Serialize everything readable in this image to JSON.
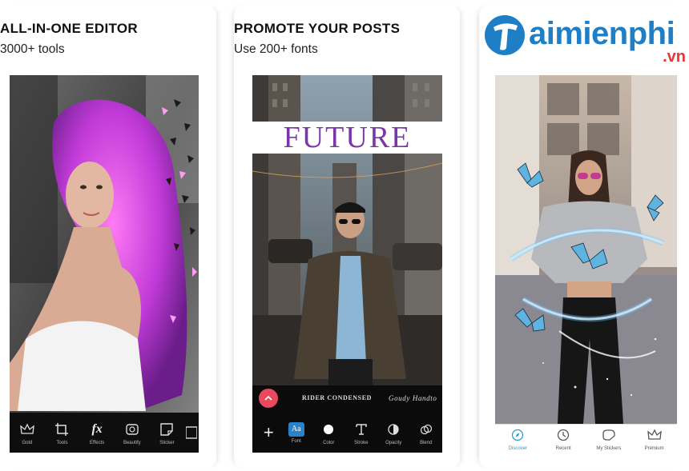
{
  "panels": [
    {
      "title": "ALL-IN-ONE EDITOR",
      "subtitle": "3000+ tools",
      "toolbar": [
        "Gold",
        "Tools",
        "Effects",
        "Beautify",
        "Sticker"
      ]
    },
    {
      "title": "PROMOTE YOUR POSTS",
      "subtitle": "Use 200+ fonts",
      "overlay_text": "FUTURE",
      "fonts": [
        "Rider Condensed",
        "Goudy Handto"
      ],
      "toolbar": [
        "Font",
        "Color",
        "Stroke",
        "Opacity",
        "Blend"
      ]
    },
    {
      "toolbar": [
        "Discover",
        "Recent",
        "My Stickers",
        "Premium"
      ]
    }
  ],
  "logo": {
    "main": "aimienphi",
    "tld": ".vn"
  },
  "colors": {
    "accent_purple": "#7a35a8",
    "fab_red": "#e8495e",
    "logo_blue": "#1e7fc7",
    "logo_red": "#e53935",
    "active_blue": "#2a9bd6"
  }
}
